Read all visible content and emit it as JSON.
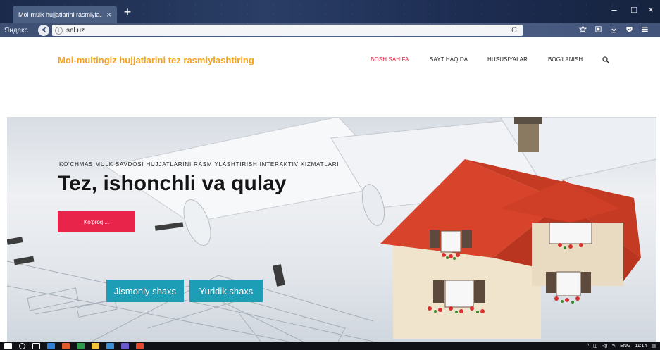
{
  "browser": {
    "tab_title": "Mol-mulk hujjatlarini rasmiyla...",
    "tab_close": "×",
    "new_tab": "+",
    "brand": "Яндекс",
    "url": "sel.uz",
    "back_glyph": "⮜",
    "reload_glyph": "C",
    "window_controls": [
      "–",
      "□",
      "×"
    ],
    "toolbar_icons": [
      "bookmark-star-icon",
      "tab-icon",
      "download-icon",
      "protect-icon",
      "menu-icon"
    ]
  },
  "site": {
    "title": "Mol-multingiz hujjatlarini tez rasmiylashtiring",
    "nav": [
      {
        "label": "BOSH SAHIFA",
        "active": true
      },
      {
        "label": "SAYT HAQIDA",
        "active": false
      },
      {
        "label": "HUSUSIYALAR",
        "active": false
      },
      {
        "label": "BOG'LANISH",
        "active": false
      }
    ]
  },
  "hero": {
    "subtitle": "KO'CHMAS MULK SAVDOSI HUJJATLARINI RASMIYLASHTIRISH INTERAKTIV XIZMATLARI",
    "title": "Tez, ishonchli va qulay",
    "more_button": "Ko'proq ...",
    "cta_individual": "Jismoniy shaxs",
    "cta_legal": "Yuridik shaxs"
  },
  "taskbar": {
    "language": "ENG",
    "time": "11:14"
  },
  "colors": {
    "brand_orange": "#f3a21d",
    "nav_active": "#e4223f",
    "more_button": "#e9244b",
    "cta": "#1d9db6"
  }
}
